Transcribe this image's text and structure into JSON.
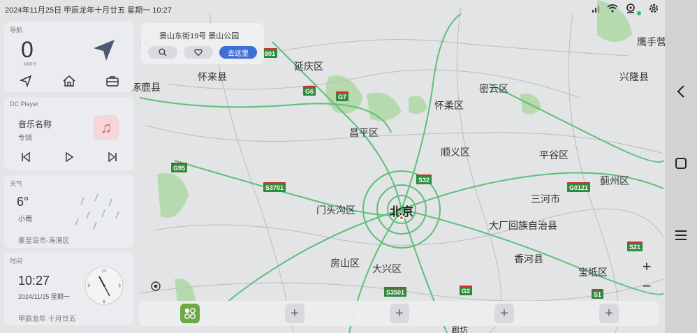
{
  "status_bar": {
    "datetime": "2024年11月25日  甲辰龙年十月廿五  星期一  10:27",
    "icons": [
      "signal-icon",
      "wifi-icon",
      "location-icon",
      "settings-icon"
    ]
  },
  "navigation_widget": {
    "title": "导航",
    "speed": "0",
    "speed_unit": "KM/H",
    "buttons": [
      "navigate-icon",
      "home-icon",
      "work-icon"
    ]
  },
  "player_widget": {
    "title": "DC Player",
    "song": "音乐名称",
    "album": "专辑",
    "buttons": [
      "previous-icon",
      "play-icon",
      "next-icon"
    ]
  },
  "weather_widget": {
    "title": "天气",
    "temperature": "6°",
    "condition": "小雨",
    "location": "秦皇岛市-海港区"
  },
  "clock_widget": {
    "title": "时间",
    "time": "10:27",
    "date": "2024/11/25  星期一",
    "lunar": "甲辰龙年  十月廿五",
    "numerals": {
      "n12": "12",
      "n3": "3",
      "n6": "6",
      "n9": "9"
    }
  },
  "address_card": {
    "address": "景山东街19号  景山公园",
    "go_label": "去这里"
  },
  "map": {
    "places": [
      {
        "id": "huailai",
        "label": "怀来县"
      },
      {
        "id": "zhuolu",
        "label": "涿鹿县"
      },
      {
        "id": "yanqing",
        "label": "延庆区"
      },
      {
        "id": "miyun",
        "label": "密云区"
      },
      {
        "id": "xinglong",
        "label": "兴隆县"
      },
      {
        "id": "yingshouying",
        "label": "鹰手营"
      },
      {
        "id": "huairou",
        "label": "怀柔区"
      },
      {
        "id": "changping",
        "label": "昌平区"
      },
      {
        "id": "shunyi",
        "label": "顺义区"
      },
      {
        "id": "pinggu",
        "label": "平谷区"
      },
      {
        "id": "jizhou",
        "label": "蓟州区"
      },
      {
        "id": "sanhe",
        "label": "三河市"
      },
      {
        "id": "mentougou",
        "label": "门头沟区"
      },
      {
        "id": "beijing",
        "label": "北京"
      },
      {
        "id": "dachang",
        "label": "大厂回族自治县"
      },
      {
        "id": "xianghe",
        "label": "香河县"
      },
      {
        "id": "fangshan",
        "label": "房山区"
      },
      {
        "id": "daxing",
        "label": "大兴区"
      },
      {
        "id": "baodi",
        "label": "宝坻区"
      },
      {
        "id": "langfang",
        "label": "廊坊"
      }
    ],
    "shields": [
      {
        "id": "s801",
        "label": "801"
      },
      {
        "id": "g6",
        "label": "G6"
      },
      {
        "id": "g7",
        "label": "G7"
      },
      {
        "id": "g95",
        "label": "G95"
      },
      {
        "id": "s3701",
        "label": "S3701"
      },
      {
        "id": "s32",
        "label": "S32"
      },
      {
        "id": "g0121",
        "label": "G0121"
      },
      {
        "id": "s21",
        "label": "S21"
      },
      {
        "id": "s3501",
        "label": "S3501"
      },
      {
        "id": "g2",
        "label": "G2"
      },
      {
        "id": "s1",
        "label": "S1"
      }
    ]
  },
  "zoom": {
    "in": "+",
    "out": "−"
  },
  "dock": {
    "slots": [
      "+",
      "+",
      "+",
      "+"
    ]
  },
  "colors": {
    "accent": "#3d6fd6",
    "road": "#5fbf79",
    "park": "#b7d9ae"
  }
}
